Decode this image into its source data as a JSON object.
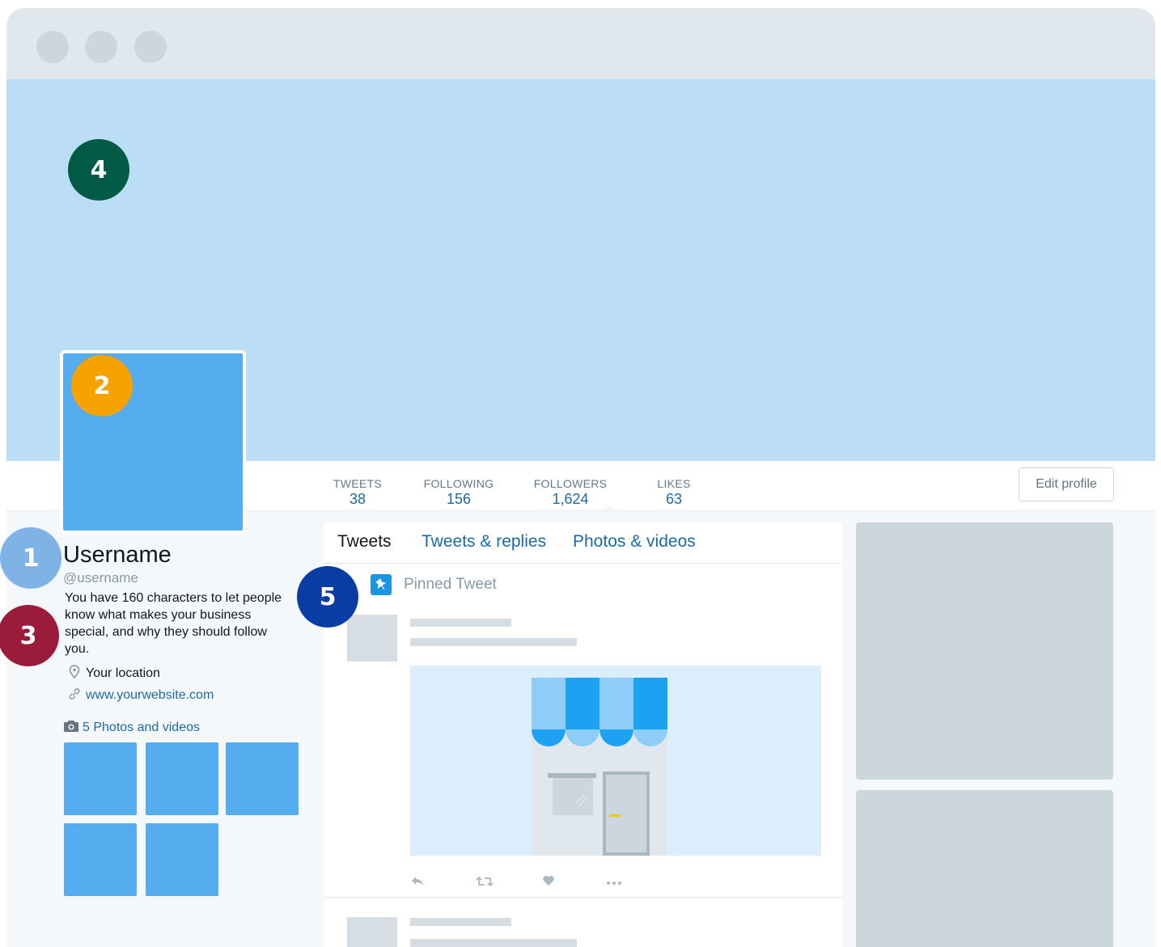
{
  "stats": [
    {
      "label": "TWEETS",
      "value": "38"
    },
    {
      "label": "FOLLOWING",
      "value": "156"
    },
    {
      "label": "FOLLOWERS",
      "value": "1,624"
    },
    {
      "label": "LIKES",
      "value": "63"
    }
  ],
  "edit_profile_label": "Edit profile",
  "profile": {
    "name": "Username",
    "handle": "@username",
    "bio": "You have 160 characters to let people know what makes your business special, and why they should follow you.",
    "location": "Your location",
    "website": "www.yourwebsite.com",
    "photos_label": "5 Photos and videos"
  },
  "tabs": [
    "Tweets",
    "Tweets & replies",
    "Photos & videos"
  ],
  "pinned_label": "Pinned Tweet",
  "markers": [
    "1",
    "2",
    "3",
    "4",
    "5"
  ],
  "colors": {
    "banner": "#bbddf5",
    "avatar": "#55acee",
    "link": "#1b6aa5",
    "marker_1": "#7fb2e5",
    "marker_2": "#f6a200",
    "marker_3": "#9b1b3a",
    "marker_4": "#005a45",
    "marker_5": "#0a3da4"
  },
  "icons": [
    "location-pin-icon",
    "link-icon",
    "camera-icon",
    "pin-icon",
    "reply-icon",
    "retweet-icon",
    "like-icon",
    "more-icon"
  ]
}
